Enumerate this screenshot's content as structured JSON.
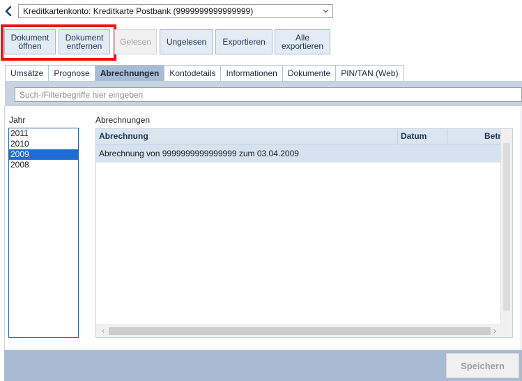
{
  "account_selector": {
    "value": "Kreditkartenkonto: Kreditkarte Postbank (9999999999999999)"
  },
  "toolbar": {
    "open_document": "Dokument öffnen",
    "remove_document": "Dokument entfernen",
    "mark_read": "Gelesen",
    "mark_unread": "Ungelesen",
    "export": "Exportieren",
    "export_all": "Alle exportieren"
  },
  "tabs": [
    {
      "label": "Umsätze"
    },
    {
      "label": "Prognose"
    },
    {
      "label": "Abrechnungen",
      "active": true
    },
    {
      "label": "Kontodetails"
    },
    {
      "label": "Informationen"
    },
    {
      "label": "Dokumente"
    },
    {
      "label": "PIN/TAN (Web)"
    }
  ],
  "search": {
    "placeholder": "Such-/Filterbegriffe hier eingeben",
    "value": ""
  },
  "years": {
    "label": "Jahr",
    "items": [
      "2011",
      "2010",
      "2009",
      "2008"
    ],
    "selected": "2009"
  },
  "statements": {
    "label": "Abrechnungen",
    "columns": [
      "Abrechnung",
      "Datum",
      "Betr"
    ],
    "rows": [
      {
        "abrechnung": "Abrechnung von 9999999999999999 zum 03.04.2009",
        "datum": "",
        "betrag": ""
      }
    ]
  },
  "footer": {
    "save": "Speichern"
  },
  "colors": {
    "accent": "#1e6dd5",
    "highlight": "#e8141a",
    "tab_active": "#a7bbd5",
    "footer": "#a9bbd3"
  },
  "icons": {
    "back": "chevron-left-icon",
    "dropdown": "chevron-down-icon"
  }
}
